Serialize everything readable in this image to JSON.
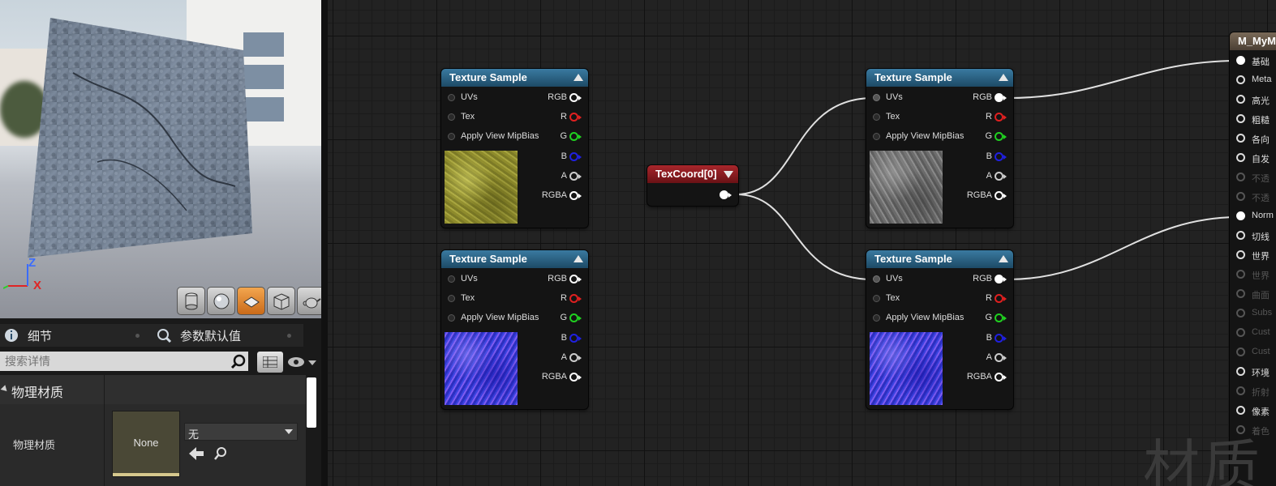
{
  "viewport": {
    "axis_z": "Z",
    "axis_x": "X",
    "preview_buttons": [
      {
        "icon": "cylinder-icon",
        "active": false
      },
      {
        "icon": "sphere-icon",
        "active": false
      },
      {
        "icon": "plane-icon",
        "active": true
      },
      {
        "icon": "cube-icon",
        "active": false
      },
      {
        "icon": "teapot-icon",
        "active": false
      }
    ]
  },
  "details_panel": {
    "tabs": [
      {
        "label": "细节",
        "icon": "details-icon"
      },
      {
        "label": "参数默认值",
        "icon": "search-icon"
      }
    ],
    "search_placeholder": "搜索详情",
    "category": "物理材质",
    "property_label": "物理材质",
    "thumbnail_text": "None",
    "combo_value": "无"
  },
  "graph": {
    "texture_nodes": [
      {
        "title": "Texture Sample",
        "preview": "moss",
        "uv_connected": false,
        "rgb_connected": false
      },
      {
        "title": "Texture Sample",
        "preview": "normal",
        "uv_connected": false,
        "rgb_connected": false
      },
      {
        "title": "Texture Sample",
        "preview": "stone",
        "uv_connected": true,
        "rgb_connected": true
      },
      {
        "title": "Texture Sample",
        "preview": "normal",
        "uv_connected": true,
        "rgb_connected": true
      }
    ],
    "input_labels": [
      "UVs",
      "Tex",
      "Apply View MipBias"
    ],
    "output_labels": [
      "RGB",
      "R",
      "G",
      "B",
      "A",
      "RGBA"
    ],
    "output_colors": [
      "#ffffff",
      "#e02020",
      "#20d020",
      "#2020e0",
      "#cccccc",
      "#ffffff"
    ],
    "texcoord_title": "TexCoord[0]",
    "result_node": {
      "title": "M_MyM",
      "inputs": [
        {
          "label": "基础",
          "state": "connected"
        },
        {
          "label": "Meta",
          "state": "on"
        },
        {
          "label": "高光",
          "state": "on"
        },
        {
          "label": "粗糙",
          "state": "on"
        },
        {
          "label": "各向",
          "state": "on"
        },
        {
          "label": "自发",
          "state": "on"
        },
        {
          "label": "不透",
          "state": "dim"
        },
        {
          "label": "不透",
          "state": "dim"
        },
        {
          "label": "Norm",
          "state": "connected"
        },
        {
          "label": "切线",
          "state": "on"
        },
        {
          "label": "世界",
          "state": "on"
        },
        {
          "label": "世界",
          "state": "dim"
        },
        {
          "label": "曲面",
          "state": "dim"
        },
        {
          "label": "Subs",
          "state": "dim"
        },
        {
          "label": "Cust",
          "state": "dim"
        },
        {
          "label": "Cust",
          "state": "dim"
        },
        {
          "label": "环境",
          "state": "on"
        },
        {
          "label": "折射",
          "state": "dim"
        },
        {
          "label": "像素",
          "state": "on"
        },
        {
          "label": "着色",
          "state": "dim"
        }
      ]
    },
    "watermark": "材质"
  }
}
